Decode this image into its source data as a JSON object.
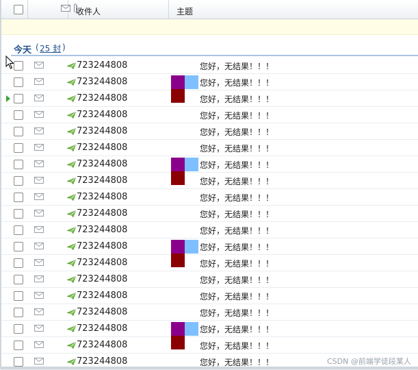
{
  "header": {
    "col_sender": "收件人",
    "col_subject": "主题",
    "icons": [
      "envelope-icon",
      "paperclip-icon"
    ]
  },
  "group": {
    "title": "今天",
    "paren_open": "(",
    "count": "25 封",
    "paren_close": ")"
  },
  "rows": [
    {
      "sender": "723244808",
      "subject": "您好，无结果！！！",
      "marker": null,
      "current": false
    },
    {
      "sender": "723244808",
      "subject": "您好，无结果！！！",
      "marker": "top",
      "current": false
    },
    {
      "sender": "723244808",
      "subject": "您好，无结果！！！",
      "marker": "bottom",
      "current": true
    },
    {
      "sender": "723244808",
      "subject": "您好，无结果！！！",
      "marker": null,
      "current": false
    },
    {
      "sender": "723244808",
      "subject": "您好，无结果！！！",
      "marker": null,
      "current": false
    },
    {
      "sender": "723244808",
      "subject": "您好，无结果！！！",
      "marker": null,
      "current": false
    },
    {
      "sender": "723244808",
      "subject": "您好，无结果！！！",
      "marker": "top",
      "current": false
    },
    {
      "sender": "723244808",
      "subject": "您好，无结果！！！",
      "marker": "bottom",
      "current": false
    },
    {
      "sender": "723244808",
      "subject": "您好，无结果！！！",
      "marker": null,
      "current": false
    },
    {
      "sender": "723244808",
      "subject": "您好，无结果！！！",
      "marker": null,
      "current": false
    },
    {
      "sender": "723244808",
      "subject": "您好，无结果！！！",
      "marker": null,
      "current": false
    },
    {
      "sender": "723244808",
      "subject": "您好，无结果！！！",
      "marker": "top",
      "current": false
    },
    {
      "sender": "723244808",
      "subject": "您好，无结果！！！",
      "marker": "bottom",
      "current": false
    },
    {
      "sender": "723244808",
      "subject": "您好，无结果！！！",
      "marker": null,
      "current": false
    },
    {
      "sender": "723244808",
      "subject": "您好，无结果！！！",
      "marker": null,
      "current": false
    },
    {
      "sender": "723244808",
      "subject": "您好，无结果！！！",
      "marker": null,
      "current": false
    },
    {
      "sender": "723244808",
      "subject": "您好，无结果！！！",
      "marker": "top",
      "current": false
    },
    {
      "sender": "723244808",
      "subject": "您好，无结果！！！",
      "marker": "bottom",
      "current": false
    },
    {
      "sender": "723244808",
      "subject": "您好，无结果！！！",
      "marker": null,
      "current": false
    }
  ],
  "colors": {
    "marker_purple": "#8b008b",
    "marker_lightblue": "#7ec0ff",
    "marker_darkred": "#8b0000",
    "group_title": "#1f4f8b",
    "current_arrow": "#3aa63a"
  },
  "watermark": "CSDN @前端学徒段某人"
}
